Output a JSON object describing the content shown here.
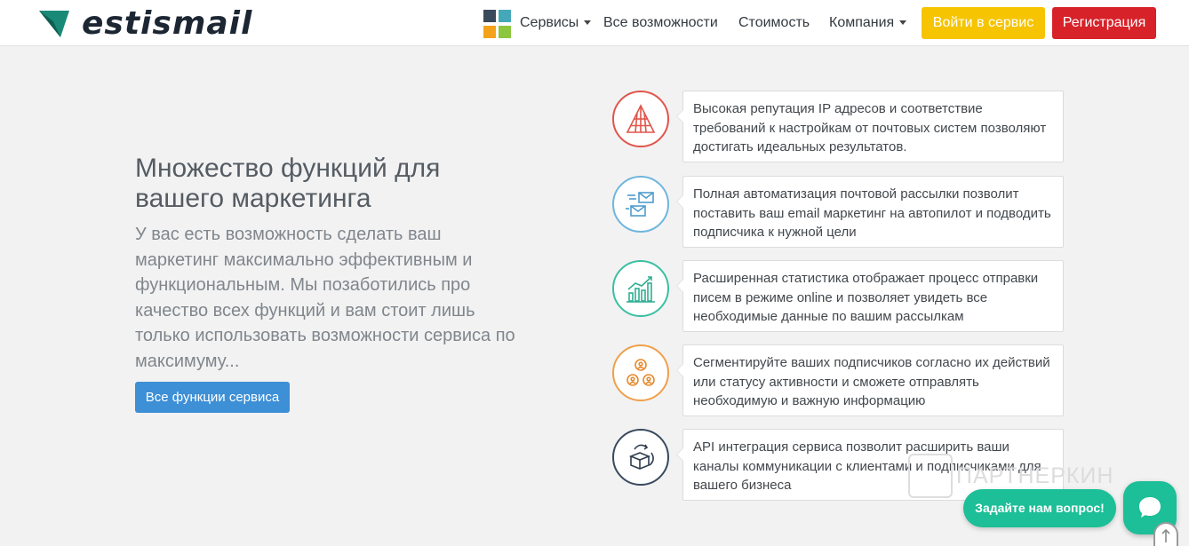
{
  "header": {
    "brand": "estismail",
    "nav": [
      {
        "label": "Сервисы",
        "has_dropdown": true
      },
      {
        "label": "Все возможности",
        "has_dropdown": false
      },
      {
        "label": "Стоимость",
        "has_dropdown": false
      },
      {
        "label": "Компания",
        "has_dropdown": true
      }
    ],
    "services_icon_colors": [
      "#3a4a5a",
      "#45a8b8",
      "#f4a21c",
      "#8dc63f"
    ],
    "login_label": "Войти в сервис",
    "register_label": "Регистрация",
    "colors": {
      "login": "#f6c400",
      "register": "#d7222a"
    }
  },
  "hero": {
    "title": "Множество функций для вашего маркетинга",
    "description": "У вас есть возможность сделать ваш маркетинг максимально эффективным и функциональным. Мы позаботились про качество всех функций и вам стоит лишь только использовать возможности сервиса по максимуму...",
    "button_label": "Все функции сервиса",
    "button_color": "#3d8fd6"
  },
  "features": [
    {
      "icon": "pyramid-icon",
      "color": "#e0554b",
      "text": "Высокая репутация IP адресов и соответствие требований к настройкам от почтовых систем позволяют достигать идеальных результатов."
    },
    {
      "icon": "email-send-icon",
      "color": "#6fb6de",
      "text": "Полная автоматизация почтовой рассылки позволит поставить ваш email маркетинг на автопилот и подводить подписчика к нужной цели"
    },
    {
      "icon": "statistics-icon",
      "color": "#3bbfa3",
      "text": "Расширенная статистика отображает процесс отправки писем в режиме online и позволяет увидеть все необходимые данные по вашим рассылкам"
    },
    {
      "icon": "segmentation-icon",
      "color": "#f0a04b",
      "text": "Сегментируйте ваших подписчиков согласно их действий или статусу активности и сможете отправлять необходимую и важную информацию"
    },
    {
      "icon": "api-integration-icon",
      "color": "#394a5e",
      "text": "API интеграция сервиса позволит расширить ваши каналы коммуникации с клиентами и подписчиками для вашего бизнеса"
    }
  ],
  "watermark": "ПАРТНЕРКИН",
  "chat": {
    "label": "Задайте нам вопрос!",
    "color": "#1cbf97"
  }
}
